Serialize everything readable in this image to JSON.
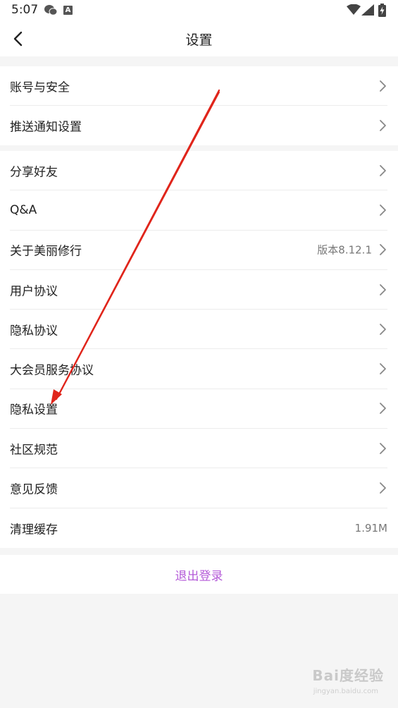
{
  "status_bar": {
    "time": "5:07",
    "icons": [
      "wechat-icon",
      "a-app-icon",
      "wifi-icon",
      "signal-icon",
      "battery-charging-icon"
    ]
  },
  "header": {
    "title": "设置",
    "back_icon": "chevron-left-icon"
  },
  "groups": [
    {
      "items": [
        {
          "label": "账号与安全",
          "value": "",
          "arrow": true
        },
        {
          "label": "推送通知设置",
          "value": "",
          "arrow": true
        }
      ]
    },
    {
      "items": [
        {
          "label": "分享好友",
          "value": "",
          "arrow": true
        },
        {
          "label": "Q&A",
          "value": "",
          "arrow": true
        },
        {
          "label": "关于美丽修行",
          "value": "版本8.12.1",
          "arrow": true
        },
        {
          "label": "用户协议",
          "value": "",
          "arrow": true
        },
        {
          "label": "隐私协议",
          "value": "",
          "arrow": true
        },
        {
          "label": "大会员服务协议",
          "value": "",
          "arrow": true
        },
        {
          "label": "隐私设置",
          "value": "",
          "arrow": true
        },
        {
          "label": "社区规范",
          "value": "",
          "arrow": true
        },
        {
          "label": "意见反馈",
          "value": "",
          "arrow": true
        },
        {
          "label": "清理缓存",
          "value": "1.91M",
          "arrow": false
        }
      ]
    }
  ],
  "logout": {
    "label": "退出登录"
  },
  "colors": {
    "accent": "#b45ad8",
    "annotation_arrow": "#e0251b",
    "background": "#f5f5f5"
  },
  "watermark": {
    "text": "Bai度经验",
    "sub": "jingyan.baidu.com"
  }
}
